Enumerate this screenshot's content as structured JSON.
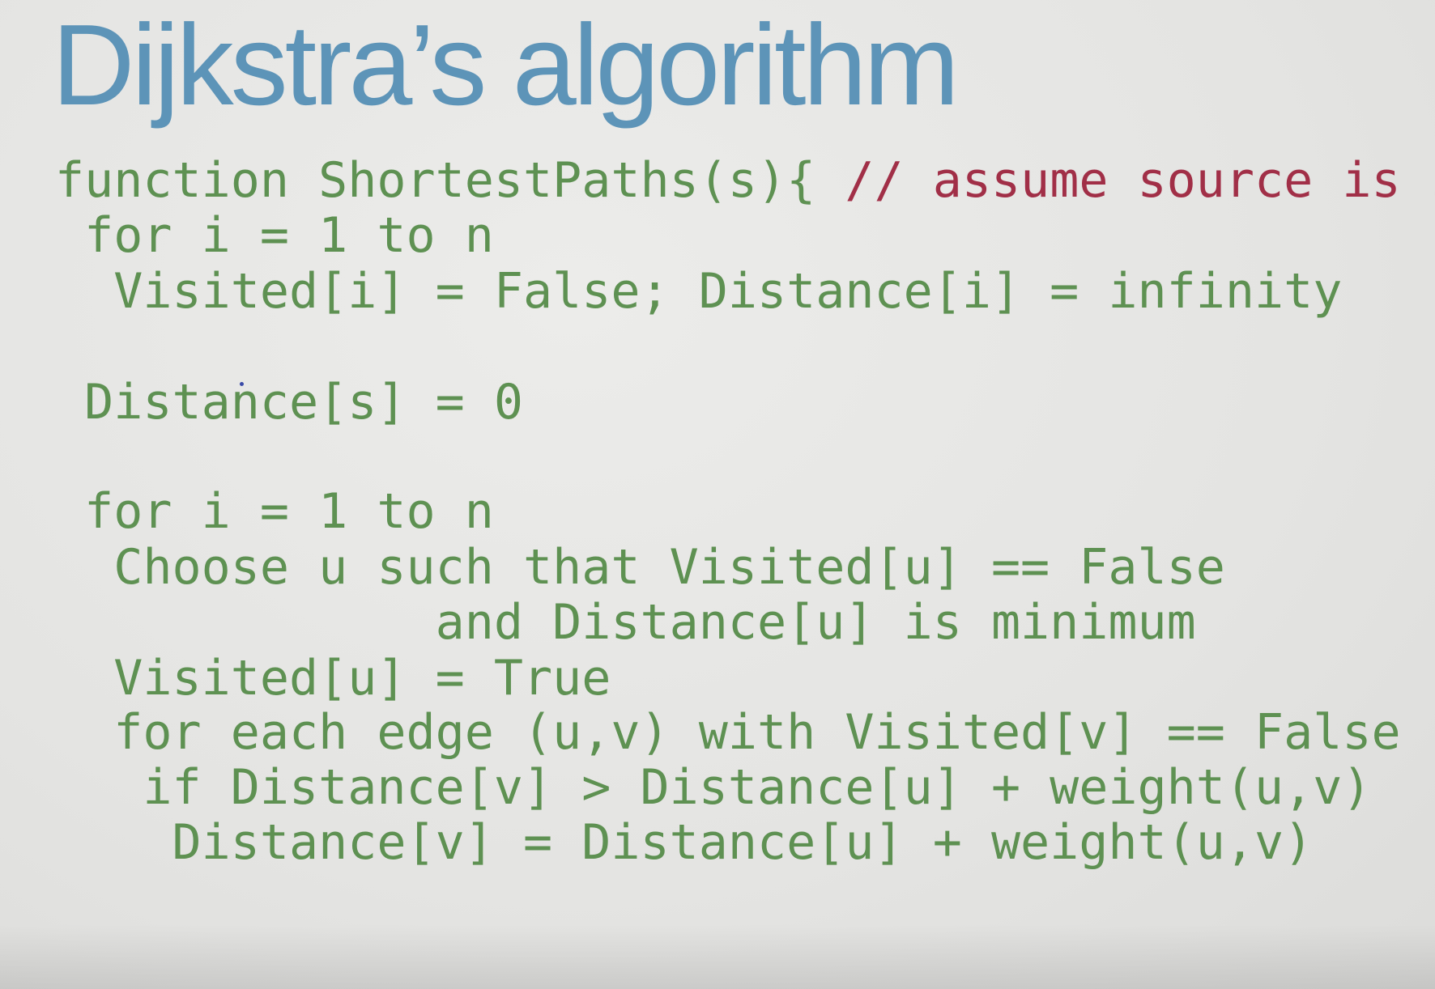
{
  "title": "Dijkstra’s algorithm",
  "code": {
    "line1": "function ShortestPaths(s){ ",
    "line1_comment": "// assume source is s",
    "line2": " for i = 1 to n",
    "line3": "  Visited[i] = False; Distance[i] = infinity",
    "line4": " Distance[s] = 0",
    "line5": " for i = 1 to n",
    "line6": "  Choose u such that Visited[u] == False",
    "line7": "             and Distance[u] is minimum",
    "line8": "  Visited[u] = True",
    "line9": "  for each edge (u,v) with Visited[v] == False",
    "line10": "   if Distance[v] > Distance[u] + weight(u,v)",
    "line11": "    Distance[v] = Distance[u] + weight(u,v)"
  },
  "colors": {
    "title": "#5d94b8",
    "code": "#5e9152",
    "comment": "#a12f47",
    "background": "#e6e6e4"
  }
}
